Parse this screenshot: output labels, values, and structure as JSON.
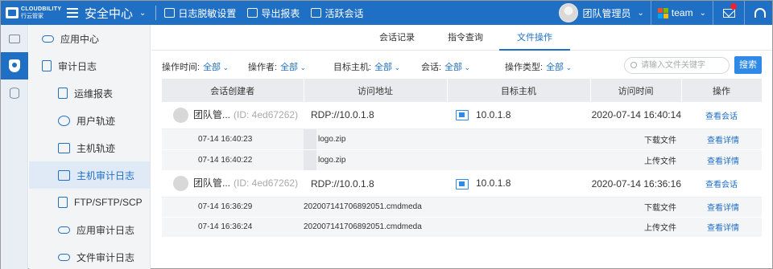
{
  "brand": {
    "en": "CLOUDBILITY",
    "cn": "行云管家"
  },
  "header": {
    "app_title": "安全中心",
    "tools": [
      "日志脱敏设置",
      "导出报表",
      "活跃会话"
    ],
    "user": "团队管理员",
    "team": "team"
  },
  "colors": {
    "primary": "#1f6fc5",
    "button": "#2e8ae6",
    "header_bg": "#e9ebee",
    "subrow_bg": "#f4f5f7"
  },
  "sidebar": {
    "items": [
      {
        "label": "应用中心",
        "icon": "cloud-app-icon"
      },
      {
        "label": "审计日志",
        "icon": "audit-log-icon"
      },
      {
        "label": "运维报表",
        "icon": "report-icon"
      },
      {
        "label": "用户轨迹",
        "icon": "user-track-icon"
      },
      {
        "label": "主机轨迹",
        "icon": "host-track-icon"
      },
      {
        "label": "主机审计日志",
        "icon": "monitor-icon",
        "active": true
      },
      {
        "label": "FTP/SFTP/SCP",
        "icon": "ftp-icon"
      },
      {
        "label": "应用审计日志",
        "icon": "cloud-icon"
      },
      {
        "label": "文件审计日志",
        "icon": "cloud-file-icon"
      }
    ]
  },
  "tabs": [
    {
      "label": "会话记录"
    },
    {
      "label": "指令查询"
    },
    {
      "label": "文件操作",
      "active": true
    }
  ],
  "filters": {
    "op_time": {
      "label": "操作时间:",
      "value": "全部"
    },
    "operator": {
      "label": "操作者:",
      "value": "全部"
    },
    "host": {
      "label": "目标主机:",
      "value": "全部"
    },
    "session": {
      "label": "会话:",
      "value": "全部"
    },
    "op_type": {
      "label": "操作类型:",
      "value": "全部"
    },
    "search_placeholder": "请输入文件关键字",
    "search_button": "搜索"
  },
  "table": {
    "headers": [
      "会话创建者",
      "访问地址",
      "目标主机",
      "访问时间",
      "操作"
    ],
    "groups": [
      {
        "creator": "团队管...",
        "id": "(ID: 4ed67262)",
        "address": "RDP://10.0.1.8",
        "host": "10.0.1.8",
        "time": "2020-07-14  16:40:14",
        "action": "查看会话",
        "files": [
          {
            "time": "07-14 16:40:23",
            "name": "logo.zip",
            "type": "下载文件",
            "action": "查看详情"
          },
          {
            "time": "07-14 16:40:22",
            "name": "logo.zip",
            "type": "上传文件",
            "action": "查看详情"
          }
        ]
      },
      {
        "creator": "团队管...",
        "id": "(ID: 4ed67262)",
        "address": "RDP://10.0.1.8",
        "host": "10.0.1.8",
        "time": "2020-07-14  16:36:16",
        "action": "查看会话",
        "files": [
          {
            "time": "07-14 16:36:29",
            "name": "20200714170689​2051.cmdmeda",
            "type": "下载文件",
            "action": "查看详情"
          },
          {
            "time": "07-14 16:36:24",
            "name": "20200714170689​2051.cmdmeda",
            "type": "上传文件",
            "action": "查看详情"
          }
        ]
      }
    ]
  }
}
